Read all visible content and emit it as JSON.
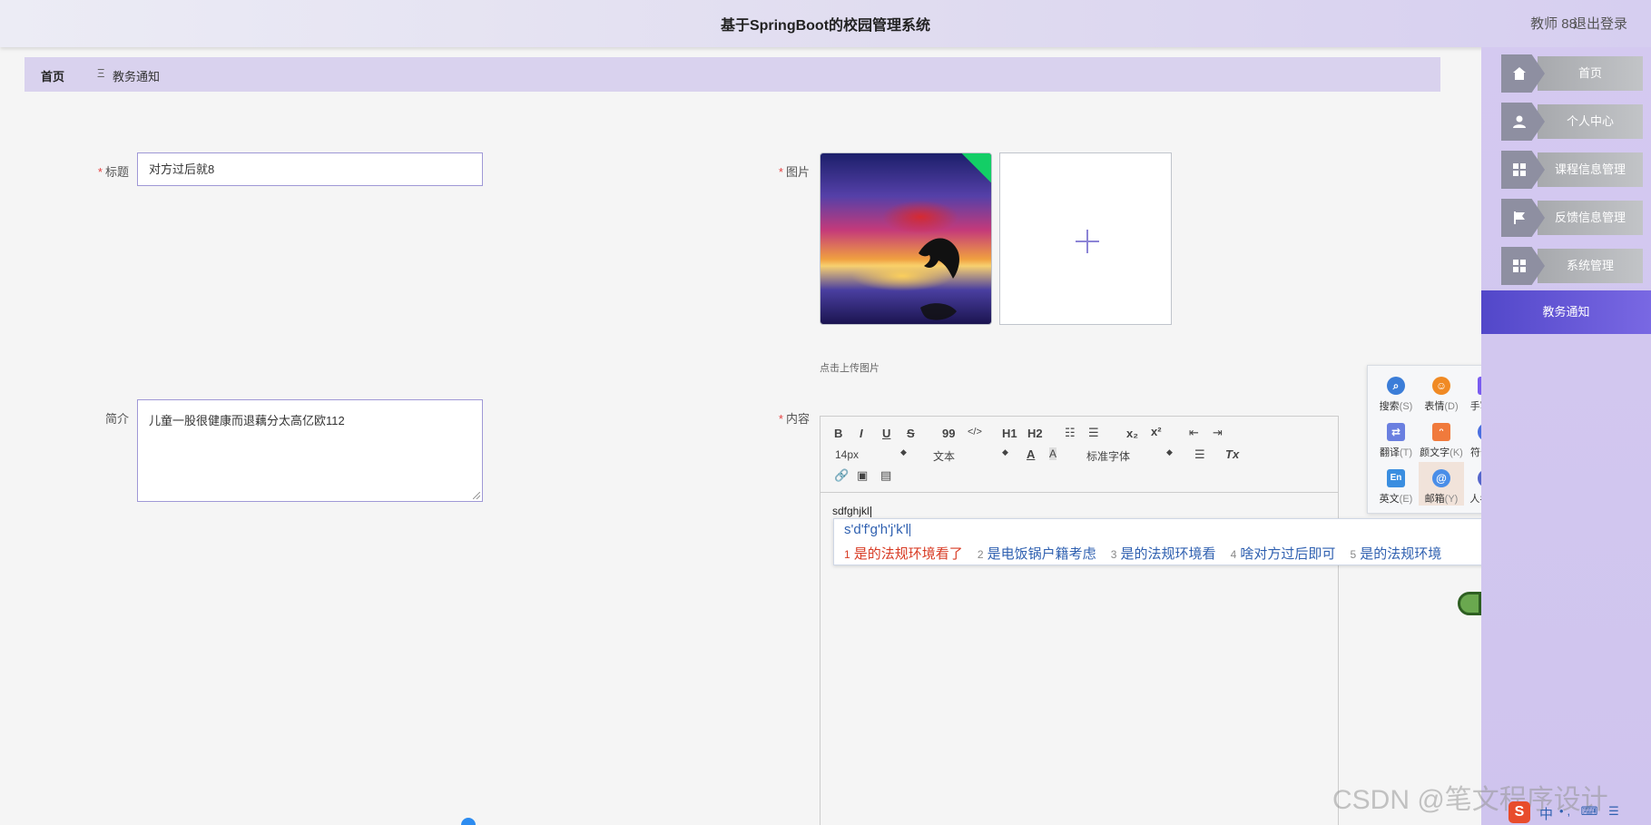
{
  "header": {
    "title": "基于SpringBoot的校园管理系统",
    "user": "教师 88",
    "logout": "退出登录"
  },
  "breadcrumb": {
    "home": "首页",
    "separator": "Ξ",
    "current": "教务通知"
  },
  "sidebar": {
    "items": [
      {
        "label": "首页",
        "icon": "home-icon"
      },
      {
        "label": "个人中心",
        "icon": "user-icon"
      },
      {
        "label": "课程信息管理",
        "icon": "grid-icon"
      },
      {
        "label": "反馈信息管理",
        "icon": "flag-icon"
      },
      {
        "label": "系统管理",
        "icon": "grid-icon"
      }
    ],
    "active": "教务通知"
  },
  "form": {
    "title_label": "标题",
    "title_value": "对方过后就8",
    "image_label": "图片",
    "upload_tip": "点击上传图片",
    "intro_label": "简介",
    "intro_value": "儿童一股很健康而退藕分太高亿欧112",
    "content_label": "内容",
    "required_mark": "*"
  },
  "editor": {
    "toolbar": {
      "bold": "B",
      "italic": "I",
      "underline": "U",
      "strike": "S",
      "quote": "99",
      "code": "</>",
      "h1": "H1",
      "h2": "H2",
      "sub": "x₂",
      "sup": "x²",
      "size": "14px",
      "text_type": "文本",
      "font": "标准字体",
      "clear": "Tx"
    },
    "content": "sdfghjkl"
  },
  "ime": {
    "pinyin": "s'd'f'g'h'j'k'l",
    "candidates": [
      {
        "n": "1",
        "text": "是的法规环境看了"
      },
      {
        "n": "2",
        "text": "是电饭锅户籍考虑"
      },
      {
        "n": "3",
        "text": "是的法规环境看"
      },
      {
        "n": "4",
        "text": "啥对方过后即可"
      },
      {
        "n": "5",
        "text": "是的法规环境"
      }
    ],
    "prev": "‹",
    "next": "›",
    "tools": [
      {
        "label": "搜索",
        "key": "(S)",
        "icon": "search-icon",
        "color": "#3b7dd8"
      },
      {
        "label": "表情",
        "key": "(D)",
        "icon": "emoji-icon",
        "color": "#f08a24"
      },
      {
        "label": "手写",
        "key": "(X)",
        "icon": "pen-icon",
        "color": "#7a5cf0"
      },
      {
        "label": "翻译",
        "key": "(T)",
        "icon": "translate-icon",
        "color": "#6a7fe0"
      },
      {
        "label": "颜文字",
        "key": "(K)",
        "icon": "kaomoji-icon",
        "color": "#f07a3c"
      },
      {
        "label": "符号",
        "key": "(F)",
        "icon": "omega-icon",
        "color": "#4a6fe0"
      },
      {
        "label": "英文",
        "key": "(E)",
        "icon": "english-icon",
        "color": "#3a8ee0"
      },
      {
        "label": "邮箱",
        "key": "(Y)",
        "icon": "at-icon",
        "color": "#4a8ee8"
      },
      {
        "label": "人名",
        "key": "(R)",
        "icon": "person-icon",
        "color": "#5566cc"
      }
    ]
  },
  "tray": {
    "logo": "S",
    "mode": "中",
    "tools": "•, ⌨ ☰"
  },
  "watermark": "CSDN @笔文程序设计"
}
